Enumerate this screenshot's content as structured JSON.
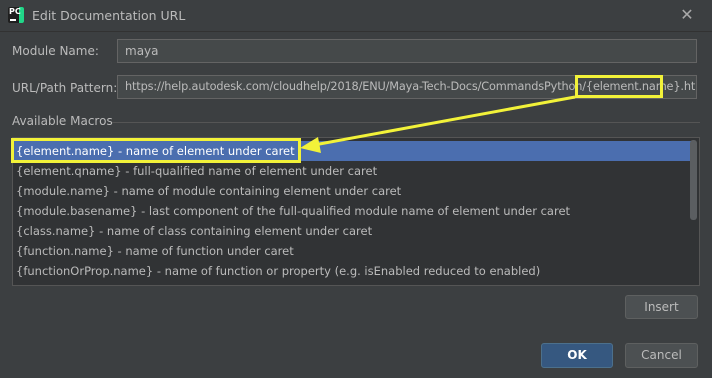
{
  "window": {
    "title": "Edit Documentation URL",
    "app_icon_label": "PC"
  },
  "form": {
    "module_name_label": "Module Name:",
    "module_name_value": "maya",
    "url_label": "URL/Path Pattern:",
    "url_value": "https://help.autodesk.com/cloudhelp/2018/ENU/Maya-Tech-Docs/CommandsPython/{element.name}.html"
  },
  "macros": {
    "section_label": "Available Macros",
    "items": [
      "{element.name} - name of element under caret",
      "{element.qname} - full-qualified name of element under caret",
      "{module.name} - name of module containing element under caret",
      "{module.basename} - last component of the full-qualified module name of element under caret",
      "{class.name} - name of class containing element under caret",
      "{function.name} - name of function under caret",
      "{functionOrProp.name} - name of function or property (e.g. isEnabled reduced to enabled)"
    ],
    "selected_index": 0
  },
  "buttons": {
    "insert": "Insert",
    "ok": "OK",
    "cancel": "Cancel"
  },
  "colors": {
    "background": "#3c3f41",
    "selection": "#4b6eaf",
    "annotation": "#f2f239",
    "ok_button": "#365880"
  },
  "icons": {
    "close": "close-icon",
    "app": "pycharm-icon"
  }
}
